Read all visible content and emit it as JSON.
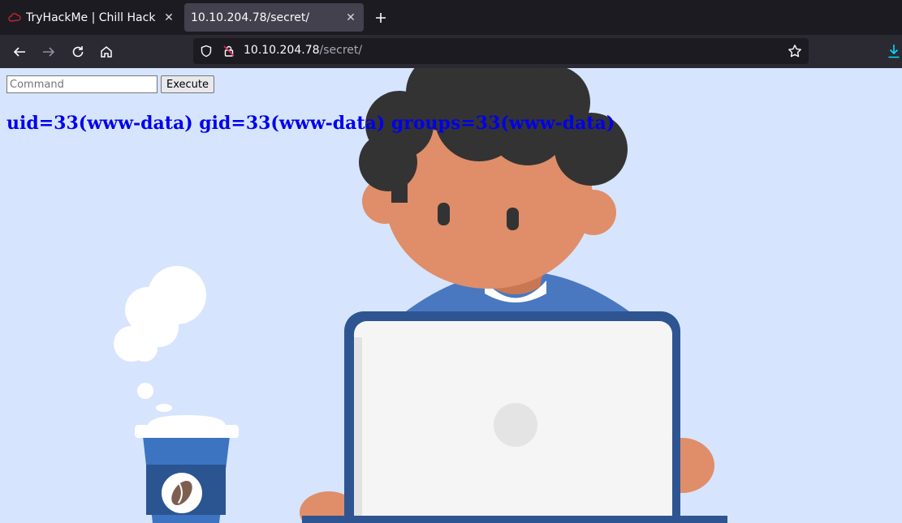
{
  "browser": {
    "tabs": [
      {
        "title": "TryHackMe | Chill Hack",
        "favicon": "tryhackme-cloud-icon",
        "active": false
      },
      {
        "title": "10.10.204.78/secret/",
        "favicon": "",
        "active": true
      }
    ],
    "new_tab_icon": "plus-icon",
    "nav": {
      "back_icon": "back-arrow-icon",
      "forward_icon": "forward-arrow-icon",
      "reload_icon": "reload-icon",
      "home_icon": "home-icon"
    },
    "url": {
      "host": "10.10.204.78",
      "path": "/secret/"
    },
    "colors": {
      "tabstrip": "#1c1b22",
      "navbar": "#2b2a33",
      "active_tab": "#42414d",
      "accent": "#00ddff",
      "insecure": "#e22850"
    }
  },
  "page": {
    "command_input": {
      "placeholder": "Command",
      "value": ""
    },
    "execute_label": "Execute",
    "output": "uid=33(www-data) gid=33(www-data) groups=33(www-data)",
    "colors": {
      "background": "#d6e5fd",
      "output_text": "#0000ee"
    }
  }
}
